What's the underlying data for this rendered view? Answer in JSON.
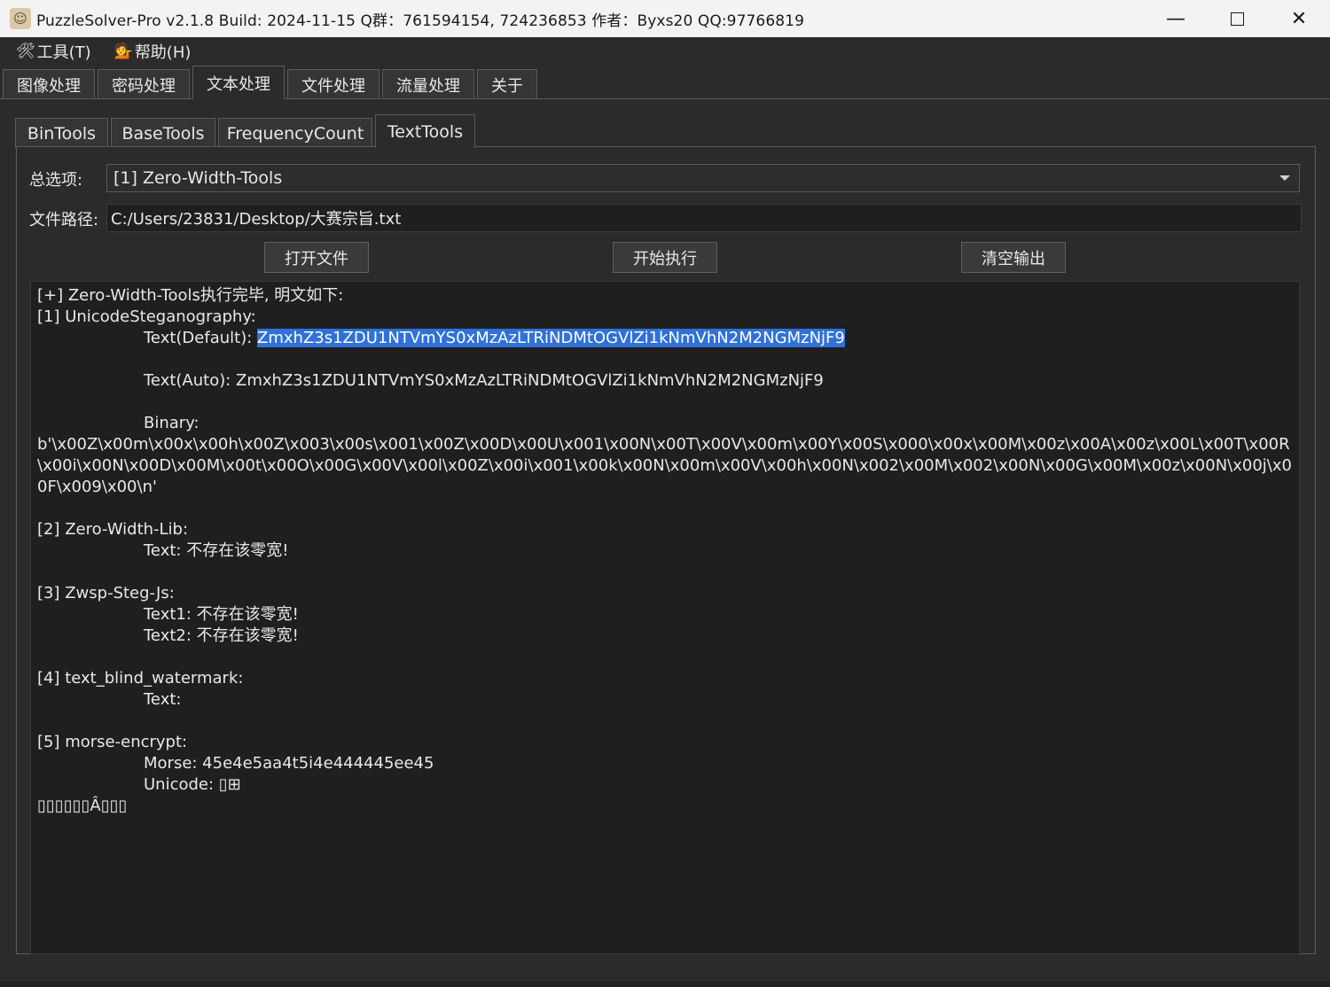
{
  "window": {
    "title": "PuzzleSolver-Pro v2.1.8  Build: 2024-11-15  Q群：761594154, 724236853  作者：Byxs20  QQ:97766819",
    "minimize": "—",
    "close": "✕"
  },
  "menu": [
    {
      "icon": "🛠",
      "label": "工具(T)"
    },
    {
      "icon": "💁",
      "label": "帮助(H)"
    }
  ],
  "main_tabs": [
    "图像处理",
    "密码处理",
    "文本处理",
    "文件处理",
    "流量处理",
    "关于"
  ],
  "main_tab_active": "文本处理",
  "sub_tabs": [
    "BinTools",
    "BaseTools",
    "FrequencyCount",
    "TextTools"
  ],
  "sub_tab_active": "TextTools",
  "form": {
    "option_label": "总选项:",
    "option_value": "[1] Zero-Width-Tools",
    "path_label": "文件路径:",
    "path_value": "C:/Users/23831/Desktop/大赛宗旨.txt"
  },
  "buttons": {
    "open": "打开文件",
    "run": "开始执行",
    "clear": "清空输出"
  },
  "output": {
    "header": "[+] Zero-Width-Tools执行完毕, 明文如下:",
    "s1_title": "[1] UnicodeSteganography:",
    "s1_default_label": "Text(Default): ",
    "s1_default_value": "ZmxhZ3s1ZDU1NTVmYS0xMzAzLTRiNDMtOGVlZi1kNmVhN2M2NGMzNjF9",
    "s1_auto": "Text(Auto): ZmxhZ3s1ZDU1NTVmYS0xMzAzLTRiNDMtOGVlZi1kNmVhN2M2NGMzNjF9",
    "s1_binary_label": "Binary:",
    "s1_binary_value": "b'\\x00Z\\x00m\\x00x\\x00h\\x00Z\\x003\\x00s\\x001\\x00Z\\x00D\\x00U\\x001\\x00N\\x00T\\x00V\\x00m\\x00Y\\x00S\\x000\\x00x\\x00M\\x00z\\x00A\\x00z\\x00L\\x00T\\x00R\\x00i\\x00N\\x00D\\x00M\\x00t\\x00O\\x00G\\x00V\\x00l\\x00Z\\x00i\\x001\\x00k\\x00N\\x00m\\x00V\\x00h\\x00N\\x002\\x00M\\x002\\x00N\\x00G\\x00M\\x00z\\x00N\\x00j\\x00F\\x009\\x00\\n'",
    "s2_title": "[2] Zero-Width-Lib:",
    "s2_text": "Text: 不存在该零宽!",
    "s3_title": "[3] Zwsp-Steg-Js:",
    "s3_text1": "Text1: 不存在该零宽!",
    "s3_text2": "Text2: 不存在该零宽!",
    "s4_title": "[4] text_blind_watermark:",
    "s4_text": "Text:",
    "s5_title": "[5] morse-encrypt:",
    "s5_morse": "Morse: 45e4e5aa4t5i4e444445ee45",
    "s5_unicode": "Unicode: ▯⊞",
    "s5_garbled": "▯▯▯▯▯▯Â▯▯▯"
  }
}
